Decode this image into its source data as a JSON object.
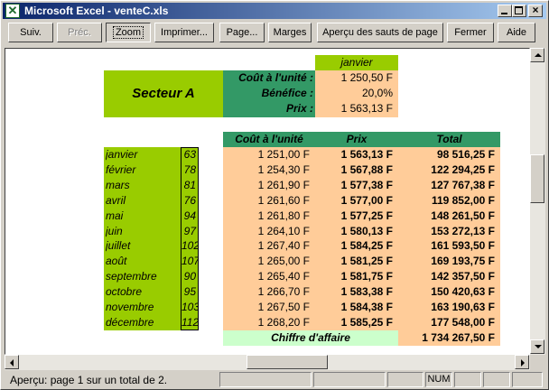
{
  "window": {
    "title": "Microsoft Excel - venteC.xls"
  },
  "toolbar": {
    "buttons": [
      "Suiv.",
      "Préc.",
      "Zoom",
      "Imprimer...",
      "Page...",
      "Marges",
      "Aperçu des sauts de page",
      "Fermer",
      "Aide"
    ]
  },
  "sheet": {
    "sector_label": "Secteur A",
    "month_header": "janvier",
    "params": [
      {
        "label": "Coût à l'unité :",
        "value": "1 250,50 F"
      },
      {
        "label": "Bénéfice :",
        "value": "20,0%"
      },
      {
        "label": "Prix :",
        "value": "1 563,13 F"
      }
    ],
    "headers": {
      "cost": "Coût à l'unité",
      "price": "Prix",
      "total": "Total"
    },
    "rows": [
      {
        "month": "janvier",
        "qty": "63",
        "cost": "1 251,00 F",
        "price": "1 563,13 F",
        "total": "98 516,25 F"
      },
      {
        "month": "février",
        "qty": "78",
        "cost": "1 254,30 F",
        "price": "1 567,88 F",
        "total": "122 294,25 F"
      },
      {
        "month": "mars",
        "qty": "81",
        "cost": "1 261,90 F",
        "price": "1 577,38 F",
        "total": "127 767,38 F"
      },
      {
        "month": "avril",
        "qty": "76",
        "cost": "1 261,60 F",
        "price": "1 577,00 F",
        "total": "119 852,00 F"
      },
      {
        "month": "mai",
        "qty": "94",
        "cost": "1 261,80 F",
        "price": "1 577,25 F",
        "total": "148 261,50 F"
      },
      {
        "month": "juin",
        "qty": "97",
        "cost": "1 264,10 F",
        "price": "1 580,13 F",
        "total": "153 272,13 F"
      },
      {
        "month": "juillet",
        "qty": "102",
        "cost": "1 267,40 F",
        "price": "1 584,25 F",
        "total": "161 593,50 F"
      },
      {
        "month": "août",
        "qty": "107",
        "cost": "1 265,00 F",
        "price": "1 581,25 F",
        "total": "169 193,75 F"
      },
      {
        "month": "septembre",
        "qty": "90",
        "cost": "1 265,40 F",
        "price": "1 581,75 F",
        "total": "142 357,50 F"
      },
      {
        "month": "octobre",
        "qty": "95",
        "cost": "1 266,70 F",
        "price": "1 583,38 F",
        "total": "150 420,63 F"
      },
      {
        "month": "novembre",
        "qty": "103",
        "cost": "1 267,50 F",
        "price": "1 584,38 F",
        "total": "163 190,63 F"
      },
      {
        "month": "décembre",
        "qty": "112",
        "cost": "1 268,20 F",
        "price": "1 585,25 F",
        "total": "177 548,00 F"
      }
    ],
    "footer": {
      "label": "Chiffre d'affaire",
      "total": "1 734 267,50 F"
    }
  },
  "status": {
    "text": "Aperçu: page 1 sur un total de 2.",
    "num": "NUM"
  },
  "colors": {
    "green": "#99cc00",
    "teal": "#339966",
    "peach": "#ffcc99",
    "mint": "#ccffcc",
    "titlebar_start": "#0a246a",
    "titlebar_end": "#a6caf0"
  }
}
